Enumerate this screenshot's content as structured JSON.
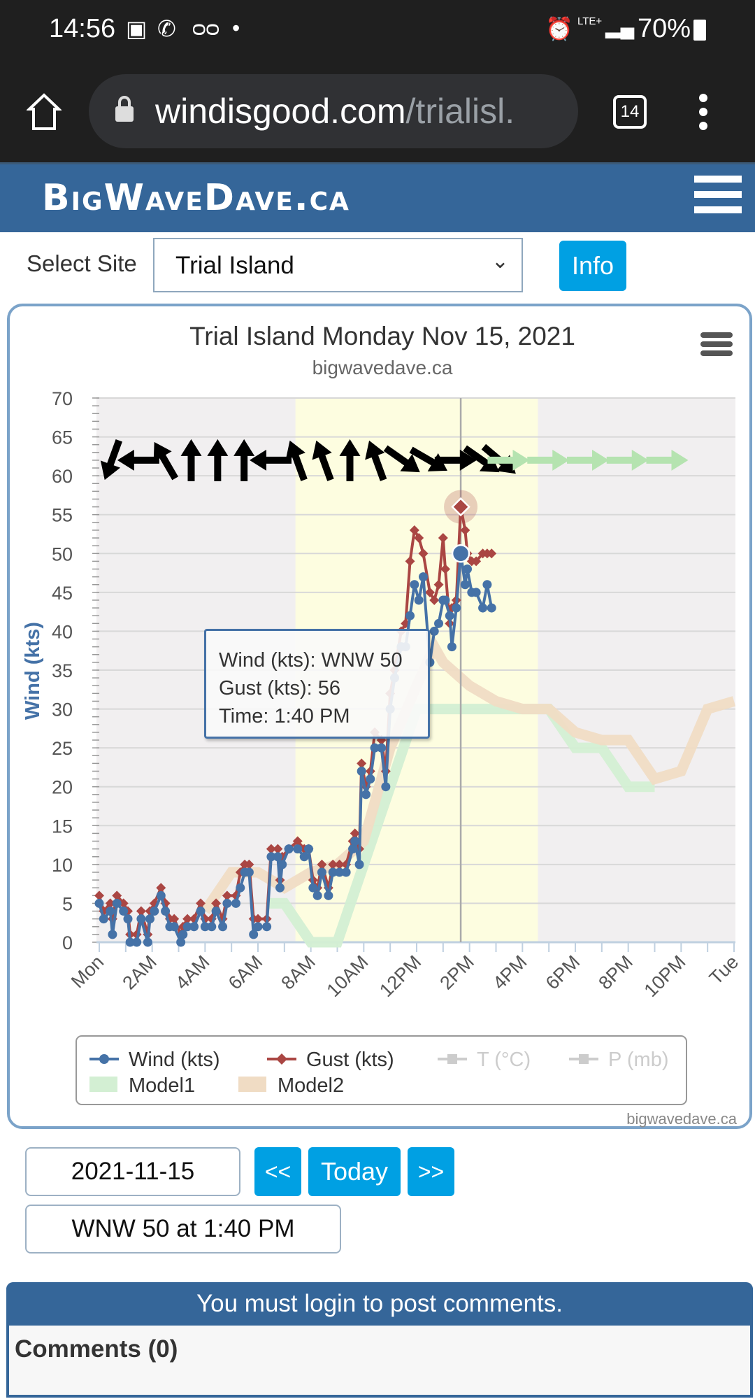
{
  "status_bar": {
    "time": "14:56",
    "battery": "70%",
    "network": "LTE+"
  },
  "browser": {
    "url_host": "windisgood.com",
    "url_path": "/trialisl.",
    "tab_count": "14"
  },
  "site": {
    "logo": "BigWaveDave.ca"
  },
  "site_select": {
    "label": "Select Site",
    "value": "Trial Island",
    "info_label": "Info"
  },
  "chart": {
    "title": "Trial Island Monday Nov 15, 2021",
    "subtitle": "bigwavedave.ca",
    "credit": "bigwavedave.ca",
    "tooltip": {
      "line1": "Wind (kts): WNW 50",
      "line2": "Gust (kts): 56",
      "line3": "Time: 1:40 PM"
    },
    "legend": [
      {
        "label": "Wind (kts)",
        "color": "#4572a7",
        "active": true
      },
      {
        "label": "Gust (kts)",
        "color": "#aa4643",
        "active": true
      },
      {
        "label": "T (°C)",
        "color": "#cccccc",
        "active": false
      },
      {
        "label": "P (mb)",
        "color": "#cccccc",
        "active": false
      },
      {
        "label": "Model1",
        "color": "#d3efd3",
        "active": true
      },
      {
        "label": "Model2",
        "color": "#f0dcc4",
        "active": true
      }
    ]
  },
  "chart_data": {
    "type": "line",
    "ylabel": "Wind (kts)",
    "ylim": [
      0,
      70
    ],
    "yticks": [
      "0",
      "5",
      "10",
      "15",
      "20",
      "25",
      "30",
      "35",
      "40",
      "45",
      "50",
      "55",
      "60",
      "65",
      "70"
    ],
    "xticks": [
      "Mon",
      "2AM",
      "4AM",
      "6AM",
      "8AM",
      "10AM",
      "12PM",
      "2PM",
      "4PM",
      "6PM",
      "8PM",
      "10PM",
      "Tue"
    ],
    "xlim": [
      "00:00",
      "24:00"
    ],
    "grid": true,
    "legend_position": "bottom",
    "daylight_band": [
      "07:25",
      "16:35"
    ],
    "crosshair_time": "13:40",
    "times": [
      "00:00",
      "00:10",
      "00:25",
      "00:30",
      "00:40",
      "00:55",
      "01:05",
      "01:10",
      "01:25",
      "01:35",
      "01:50",
      "01:55",
      "02:05",
      "02:20",
      "02:30",
      "02:40",
      "02:50",
      "03:05",
      "03:10",
      "03:20",
      "03:35",
      "03:50",
      "04:00",
      "04:15",
      "04:25",
      "04:40",
      "04:50",
      "05:10",
      "05:20",
      "05:30",
      "05:40",
      "05:50",
      "06:00",
      "06:20",
      "06:30",
      "06:45",
      "06:50",
      "06:55",
      "07:10",
      "07:30",
      "07:45",
      "07:55",
      "08:05",
      "08:15",
      "08:25",
      "08:40",
      "08:50",
      "09:05",
      "09:20",
      "09:35",
      "09:40",
      "09:50",
      "09:55",
      "10:05",
      "10:15",
      "10:25",
      "10:40",
      "10:50",
      "11:00",
      "11:10",
      "11:25",
      "11:35",
      "11:45",
      "11:55",
      "12:05",
      "12:15",
      "12:30",
      "12:40",
      "12:50",
      "13:00",
      "13:05",
      "13:15",
      "13:20",
      "13:30",
      "13:40",
      "13:50",
      "13:55",
      "14:05",
      "14:15",
      "14:30",
      "14:40",
      "14:50"
    ],
    "series": [
      {
        "name": "Wind (kts)",
        "color": "#4572a7",
        "values": [
          5,
          3,
          4,
          1,
          5,
          4,
          3,
          0,
          0,
          3,
          0,
          3,
          4,
          6,
          4,
          2,
          2,
          0,
          1,
          2,
          2,
          4,
          2,
          2,
          4,
          2,
          5,
          5,
          7,
          9,
          9,
          1,
          2,
          2,
          11,
          11,
          7,
          10,
          12,
          12,
          11,
          12,
          7,
          6,
          9,
          6,
          9,
          9,
          9,
          12,
          13,
          10,
          22,
          19,
          21,
          25,
          25,
          20,
          30,
          34,
          38,
          38,
          42,
          46,
          44,
          47,
          36,
          40,
          41,
          44,
          44,
          42,
          38,
          43,
          50,
          46,
          48,
          45,
          45,
          43,
          46,
          43
        ]
      },
      {
        "name": "Gust (kts)",
        "color": "#aa4643",
        "values": [
          6,
          4,
          5,
          3,
          6,
          5,
          4,
          1,
          1,
          4,
          1,
          4,
          5,
          7,
          5,
          3,
          3,
          1,
          2,
          3,
          3,
          5,
          3,
          3,
          5,
          3,
          6,
          6,
          9,
          10,
          10,
          3,
          3,
          3,
          12,
          12,
          8,
          11,
          12,
          13,
          12,
          12,
          8,
          7,
          10,
          7,
          10,
          10,
          10,
          13,
          14,
          12,
          23,
          20,
          22,
          27,
          26,
          22,
          32,
          35,
          40,
          41,
          49,
          53,
          52,
          50,
          45,
          44,
          46,
          52,
          48,
          41,
          43,
          44,
          56,
          53,
          50,
          49,
          49,
          50,
          50,
          50
        ]
      }
    ],
    "models": [
      {
        "name": "Model1",
        "color": "#d3efd3",
        "points": [
          [
            "06:20",
            5
          ],
          [
            "07:00",
            5
          ],
          [
            "08:00",
            0
          ],
          [
            "09:00",
            0
          ],
          [
            "10:00",
            10
          ],
          [
            "11:00",
            20
          ],
          [
            "12:00",
            30
          ],
          [
            "13:00",
            30
          ],
          [
            "14:00",
            30
          ],
          [
            "15:00",
            30
          ],
          [
            "16:00",
            30
          ],
          [
            "17:00",
            30
          ],
          [
            "18:00",
            25
          ],
          [
            "19:00",
            25
          ],
          [
            "20:00",
            20
          ],
          [
            "21:00",
            20
          ]
        ]
      },
      {
        "name": "Model2",
        "color": "#f0dcc4",
        "points": [
          [
            "04:00",
            4
          ],
          [
            "05:00",
            9
          ],
          [
            "06:00",
            9
          ],
          [
            "07:00",
            7
          ],
          [
            "08:00",
            9
          ],
          [
            "09:00",
            10
          ],
          [
            "10:00",
            13
          ],
          [
            "11:00",
            25
          ],
          [
            "12:00",
            33
          ],
          [
            "12:40",
            38
          ],
          [
            "13:00",
            36
          ],
          [
            "14:00",
            33
          ],
          [
            "15:00",
            31
          ],
          [
            "16:00",
            30
          ],
          [
            "17:00",
            30
          ],
          [
            "18:00",
            27
          ],
          [
            "19:00",
            26
          ],
          [
            "20:00",
            26
          ],
          [
            "21:00",
            21
          ],
          [
            "22:00",
            22
          ],
          [
            "23:00",
            30
          ],
          [
            "24:00",
            31
          ]
        ]
      }
    ],
    "direction_observed": {
      "color": "#000000",
      "times": [
        "00:00",
        "01:00",
        "02:00",
        "03:00",
        "04:00",
        "05:00",
        "06:00",
        "07:00",
        "08:00",
        "09:00",
        "10:00",
        "11:00",
        "12:00",
        "13:00",
        "14:00",
        "14:40"
      ],
      "from_deg": [
        20,
        90,
        150,
        180,
        180,
        180,
        90,
        160,
        160,
        180,
        160,
        305,
        300,
        270,
        305,
        310
      ]
    },
    "direction_forecast": {
      "color": "#b5e3b0",
      "times": [
        "15:00",
        "16:30",
        "18:00",
        "19:30",
        "21:00"
      ],
      "from_deg": [
        270,
        270,
        270,
        270,
        270
      ]
    },
    "highlight": {
      "time": "13:40",
      "wind": 50,
      "gust": 56,
      "direction": "WNW"
    }
  },
  "controls": {
    "date": "2021-11-15",
    "prev": "<<",
    "today": "Today",
    "next": ">>",
    "current": "WNW 50 at 1:40 PM"
  },
  "comments": {
    "notice": "You must login to post comments.",
    "count_label": "Comments (0)"
  }
}
